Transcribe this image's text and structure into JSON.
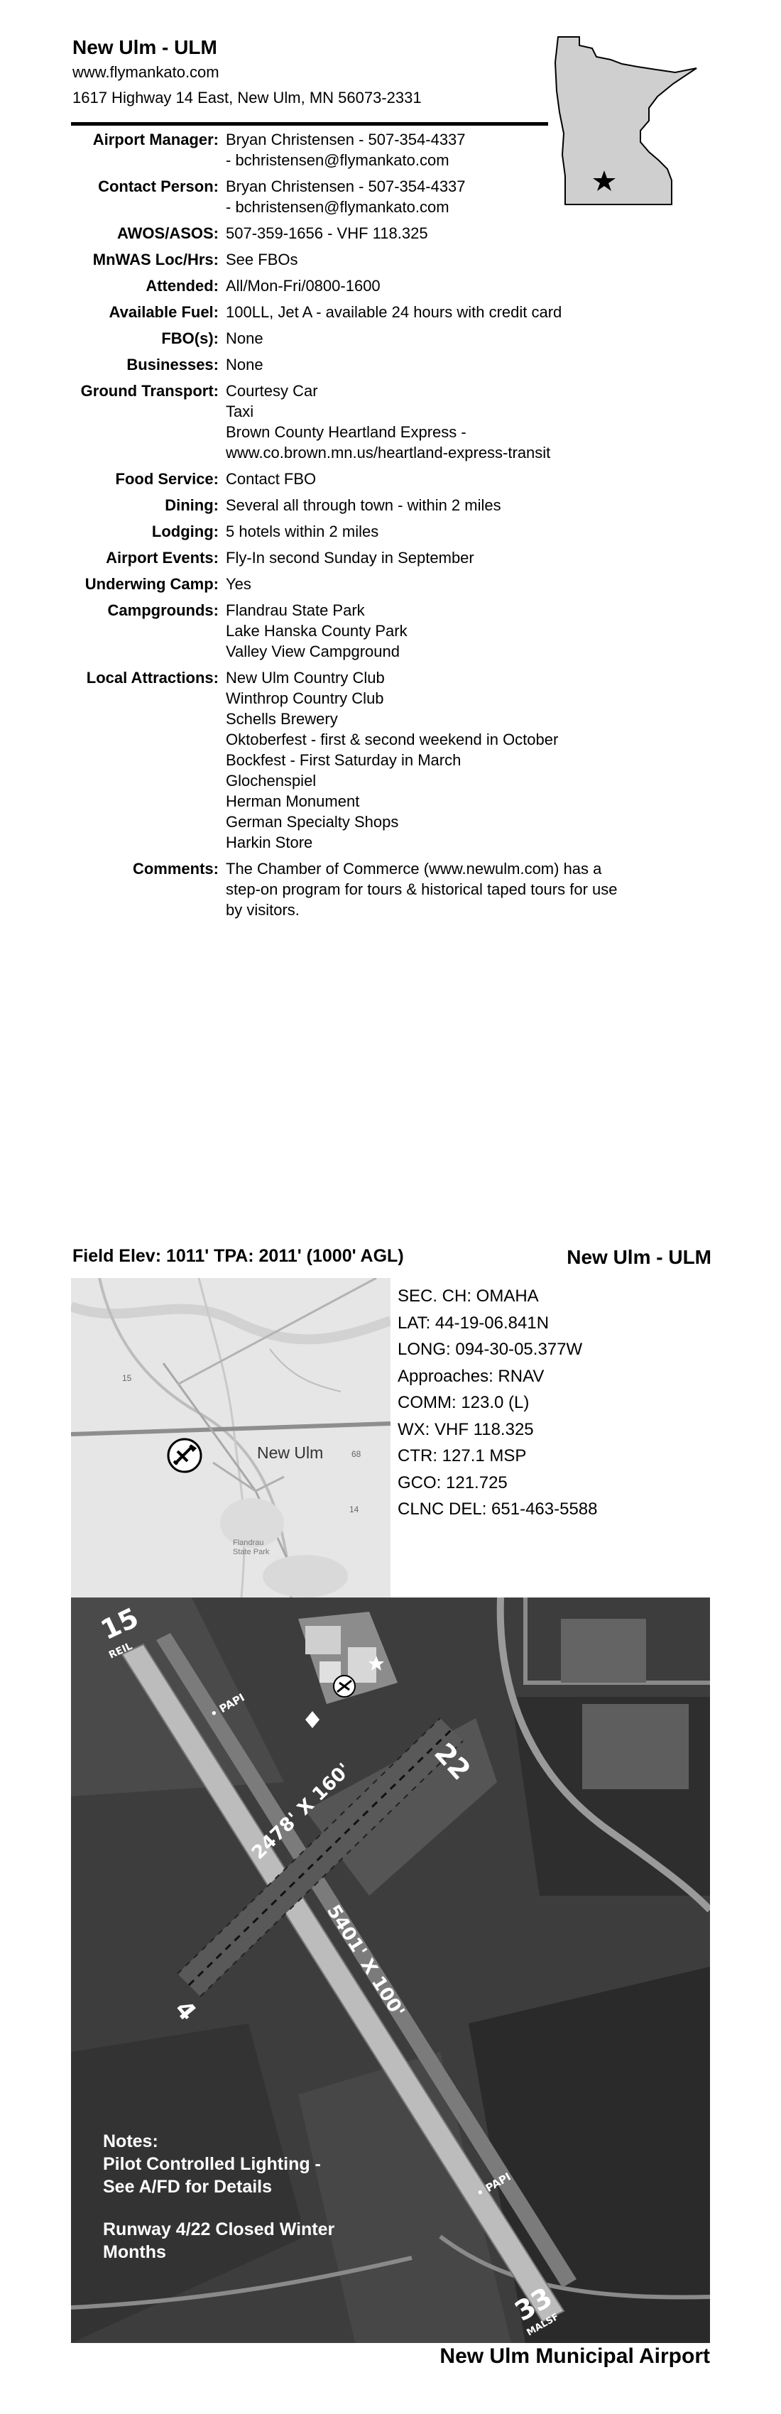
{
  "header": {
    "title": "New Ulm - ULM",
    "website": "www.flymankato.com",
    "address": "1617 Highway 14 East, New Ulm, MN 56073-2331"
  },
  "info": {
    "airport_manager": {
      "label": "Airport Manager:",
      "lines": [
        "Bryan Christensen - 507-354-4337",
        "- bchristensen@flymankato.com"
      ]
    },
    "contact_person": {
      "label": "Contact Person:",
      "lines": [
        "Bryan Christensen - 507-354-4337",
        "- bchristensen@flymankato.com"
      ]
    },
    "awos": {
      "label": "AWOS/ASOS:",
      "value": "507-359-1656 - VHF 118.325"
    },
    "mnwas": {
      "label": "MnWAS Loc/Hrs:",
      "value": "See FBOs"
    },
    "attended": {
      "label": "Attended:",
      "value": "All/Mon-Fri/0800-1600"
    },
    "fuel": {
      "label": "Available Fuel:",
      "value": "100LL, Jet A - available 24 hours with credit card"
    },
    "fbo": {
      "label": "FBO(s):",
      "value": "None"
    },
    "businesses": {
      "label": "Businesses:",
      "value": "None"
    },
    "ground_transport": {
      "label": "Ground Transport:",
      "lines": [
        "Courtesy Car",
        "Taxi",
        "Brown County Heartland Express -",
        "www.co.brown.mn.us/heartland-express-transit"
      ]
    },
    "food": {
      "label": "Food Service:",
      "value": "Contact FBO"
    },
    "dining": {
      "label": "Dining:",
      "value": "Several all through town - within 2 miles"
    },
    "lodging": {
      "label": "Lodging:",
      "value": "5 hotels within 2 miles"
    },
    "events": {
      "label": "Airport Events:",
      "value": "Fly-In second Sunday in September"
    },
    "underwing": {
      "label": "Underwing Camp:",
      "value": "Yes"
    },
    "campgrounds": {
      "label": "Campgrounds:",
      "lines": [
        "Flandrau State Park",
        "Lake Hanska County Park",
        "Valley View Campground"
      ]
    },
    "attractions": {
      "label": "Local Attractions:",
      "lines": [
        "New Ulm Country Club",
        "Winthrop Country Club",
        "Schells Brewery",
        "Oktoberfest - first & second weekend in October",
        "Bockfest - First Saturday in March",
        "Glochenspiel",
        "Herman Monument",
        "German Specialty Shops",
        "Harkin Store"
      ]
    },
    "comments": {
      "label": "Comments:",
      "lines": [
        "The Chamber of Commerce (www.newulm.com) has a",
        "step-on program for tours & historical taped tours for use",
        "by visitors."
      ]
    }
  },
  "chart_section": {
    "field_elev": "Field Elev: 1011'  TPA: 2011' (1000' AGL)",
    "title": "New Ulm - ULM"
  },
  "frequencies": {
    "sec_ch": "SEC. CH:  OMAHA",
    "lat": "LAT:      44-19-06.841N",
    "long": "LONG:  094-30-05.377W",
    "approaches": "Approaches:  RNAV",
    "comm": "COMM: 123.0 (L)",
    "wx": "WX: VHF 118.325",
    "ctr": "CTR: 127.1 MSP",
    "gco": "GCO: 121.725",
    "clnc": "CLNC DEL: 651-463-5588"
  },
  "location_map": {
    "city": "New Ulm",
    "park": "Flandrau\nState Park",
    "road_labels": [
      "15",
      "68",
      "14"
    ]
  },
  "diagram": {
    "rwy_15": "15",
    "reil": "REIL",
    "rwy_22": "22",
    "rwy_4": "4",
    "rwy_33": "33",
    "malsf": "MALSF",
    "papi_top": "• PAPI",
    "papi_bottom": "• PAPI",
    "dim_main": "5401' X 100'",
    "dim_cross": "2478' X 160'",
    "notes": {
      "heading": "Notes:",
      "line1": "Pilot Controlled Lighting -",
      "line2": "See A/FD for Details",
      "line3": "Runway 4/22 Closed Winter",
      "line4": "Months"
    }
  },
  "footer": {
    "name": "New Ulm Municipal Airport"
  },
  "colors": {
    "text": "#000000",
    "state_fill": "#cfcfcf",
    "aerial_dark": "#3a3a3a",
    "runway": "#b9b9b9"
  }
}
